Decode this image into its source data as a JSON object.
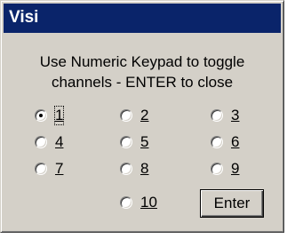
{
  "window": {
    "title": "Visi"
  },
  "message": {
    "line1": "Use Numeric Keypad to toggle",
    "line2": "channels - ENTER to close"
  },
  "channels": [
    {
      "label": "1",
      "checked": true
    },
    {
      "label": "2",
      "checked": false
    },
    {
      "label": "3",
      "checked": false
    },
    {
      "label": "4",
      "checked": false
    },
    {
      "label": "5",
      "checked": false
    },
    {
      "label": "6",
      "checked": false
    },
    {
      "label": "7",
      "checked": false
    },
    {
      "label": "8",
      "checked": false
    },
    {
      "label": "9",
      "checked": false
    },
    {
      "label": "10",
      "checked": false
    }
  ],
  "buttons": {
    "enter_label": "Enter"
  },
  "colors": {
    "titlebar": "#0a246a",
    "dialog_face": "#d4d0c8"
  }
}
